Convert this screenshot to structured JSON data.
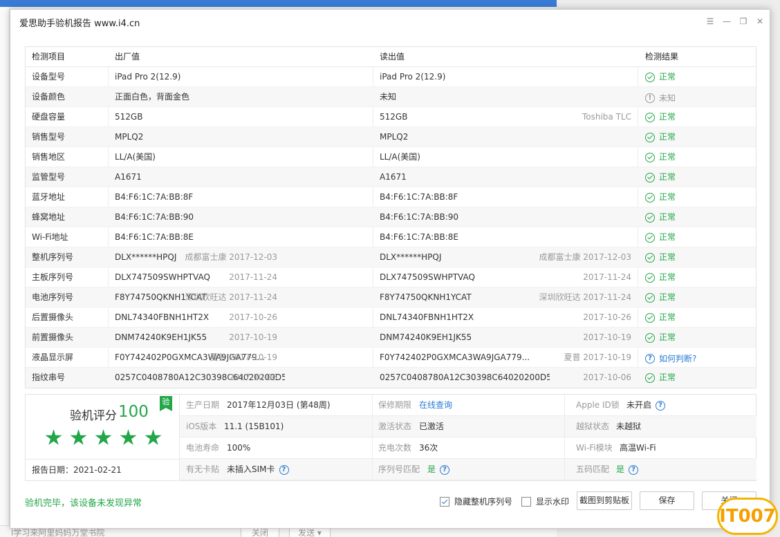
{
  "window": {
    "title": "爱思助手验机报告 www.i4.cn"
  },
  "table": {
    "headers": {
      "item": "检测项目",
      "factory": "出厂值",
      "read": "读出值",
      "result": "检测结果"
    },
    "rows": [
      {
        "item": "设备型号",
        "factory": "iPad Pro 2(12.9)",
        "factory_note": "",
        "read": "iPad Pro 2(12.9)",
        "read_note": "",
        "result": "正常",
        "status": "ok"
      },
      {
        "item": "设备颜色",
        "factory": "正面白色，背面金色",
        "factory_note": "",
        "read": "未知",
        "read_note": "",
        "result": "未知",
        "status": "unknown"
      },
      {
        "item": "硬盘容量",
        "factory": "512GB",
        "factory_note": "",
        "read": "512GB",
        "read_note": "Toshiba TLC",
        "result": "正常",
        "status": "ok"
      },
      {
        "item": "销售型号",
        "factory": "MPLQ2",
        "factory_note": "",
        "read": "MPLQ2",
        "read_note": "",
        "result": "正常",
        "status": "ok"
      },
      {
        "item": "销售地区",
        "factory": "LL/A(美国)",
        "factory_note": "",
        "read": "LL/A(美国)",
        "read_note": "",
        "result": "正常",
        "status": "ok"
      },
      {
        "item": "监管型号",
        "factory": "A1671",
        "factory_note": "",
        "read": "A1671",
        "read_note": "",
        "result": "正常",
        "status": "ok"
      },
      {
        "item": "蓝牙地址",
        "factory": "B4:F6:1C:7A:BB:8F",
        "factory_note": "",
        "read": "B4:F6:1C:7A:BB:8F",
        "read_note": "",
        "result": "正常",
        "status": "ok"
      },
      {
        "item": "蜂窝地址",
        "factory": "B4:F6:1C:7A:BB:90",
        "factory_note": "",
        "read": "B4:F6:1C:7A:BB:90",
        "read_note": "",
        "result": "正常",
        "status": "ok"
      },
      {
        "item": "Wi-Fi地址",
        "factory": "B4:F6:1C:7A:BB:8E",
        "factory_note": "",
        "read": "B4:F6:1C:7A:BB:8E",
        "read_note": "",
        "result": "正常",
        "status": "ok"
      },
      {
        "item": "整机序列号",
        "factory": "DLX******HPQJ",
        "factory_note": "成都富士康 2017-12-03",
        "read": "DLX******HPQJ",
        "read_note": "成都富士康 2017-12-03",
        "result": "正常",
        "status": "ok"
      },
      {
        "item": "主板序列号",
        "factory": "DLX747509SWHPTVAQ",
        "factory_note": "2017-11-24",
        "read": "DLX747509SWHPTVAQ",
        "read_note": "2017-11-24",
        "result": "正常",
        "status": "ok"
      },
      {
        "item": "电池序列号",
        "factory": "F8Y74750QKNH1YCAT",
        "factory_note": "深圳欣旺达 2017-11-24",
        "read": "F8Y74750QKNH1YCAT",
        "read_note": "深圳欣旺达 2017-11-24",
        "result": "正常",
        "status": "ok"
      },
      {
        "item": "后置摄像头",
        "factory": "DNL74340FBNH1HT2X",
        "factory_note": "2017-10-26",
        "read": "DNL74340FBNH1HT2X",
        "read_note": "2017-10-26",
        "result": "正常",
        "status": "ok"
      },
      {
        "item": "前置摄像头",
        "factory": "DNM74240K9EH1JK55",
        "factory_note": "2017-10-19",
        "read": "DNM74240K9EH1JK55",
        "read_note": "2017-10-19",
        "result": "正常",
        "status": "ok"
      },
      {
        "item": "液晶显示屏",
        "factory": "F0Y742402P0GXMCA3WA9JGA779...",
        "factory_note": "夏普 2017-10-19",
        "read": "F0Y742402P0GXMCA3WA9JGA779...",
        "read_note": "夏普 2017-10-19",
        "result": "如何判断?",
        "status": "question"
      },
      {
        "item": "指纹串号",
        "factory": "0257C0408780A12C30398C64020200D5",
        "factory_note": "2017-10-06",
        "read": "0257C0408780A12C30398C64020200D5",
        "read_note": "2017-10-06",
        "result": "正常",
        "status": "ok"
      }
    ]
  },
  "score": {
    "label": "验机评分",
    "value": "100",
    "badge": "验",
    "stars": 5
  },
  "report_date": "报告日期：2021-02-21",
  "info": {
    "prod_date_label": "生产日期",
    "prod_date": "2017年12月03日 (第48周)",
    "warranty_label": "保修期限",
    "warranty": "在线查询",
    "appleid_label": "Apple ID锁",
    "appleid": "未开启",
    "ios_label": "iOS版本",
    "ios": "11.1 (15B101)",
    "activation_label": "激活状态",
    "activation": "已激活",
    "jailbreak_label": "越狱状态",
    "jailbreak": "未越狱",
    "battery_label": "电池寿命",
    "battery": "100%",
    "charge_label": "充电次数",
    "charge": "36次",
    "wifi_label": "Wi-Fi模块",
    "wifi": "高温Wi-Fi",
    "sim_label": "有无卡贴",
    "sim": "未插入SIM卡",
    "serial_match_label": "序列号匹配",
    "serial_match": "是",
    "five_code_label": "五码匹配",
    "five_code": "是"
  },
  "footer": {
    "message": "验机完毕，该设备未发现异常",
    "hide_serial_label": "隐藏整机序列号",
    "hide_serial_checked": true,
    "watermark_label": "显示水印",
    "watermark_checked": false,
    "screenshot_btn": "截图到剪贴板",
    "save_btn": "保存",
    "close_btn": "关闭"
  },
  "background": {
    "bottom_text": "l学习来阿里妈妈万堂书院",
    "close_btn": "关闭",
    "send_btn": "发送 ▾"
  },
  "corner_logo": "IT007",
  "colors": {
    "green": "#22a648",
    "blue": "#2b7bd3",
    "gray": "#999999"
  }
}
